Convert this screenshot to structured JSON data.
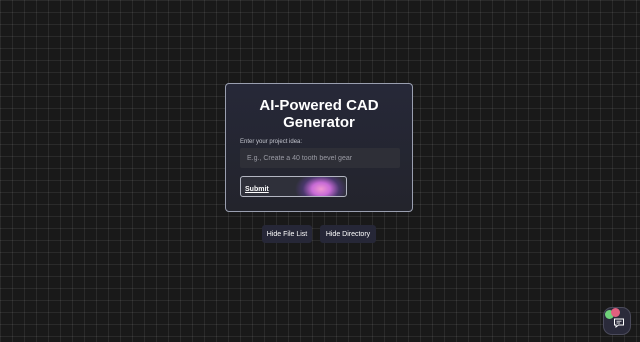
{
  "card": {
    "title": "AI-Powered CAD Generator",
    "input_label": "Enter your project idea:",
    "input_placeholder": "E.g., Create a 40 tooth bevel gear",
    "input_value": "",
    "submit_label": "Submit"
  },
  "actions": {
    "hide_file_list": "Hide File List",
    "hide_directory": "Hide Directory"
  },
  "chat_widget": {
    "icon": "chat-bubble-icon",
    "colors": {
      "green": "#6fd17a",
      "pink": "#e0607e"
    }
  }
}
